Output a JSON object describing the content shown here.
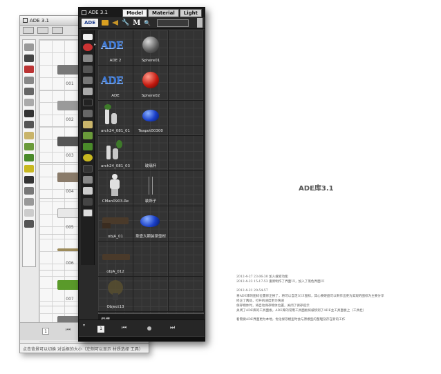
{
  "back_window": {
    "title": "ADE 3.1",
    "toolbar": [
      "",
      "",
      ""
    ],
    "cell_labels": [
      "001",
      "002",
      "003",
      "004",
      "005",
      "006",
      "007",
      "008"
    ],
    "page_number": "1",
    "status_text": "点击背景可以切换 对话框的大小（左侧可以显示 材质选择 工具）"
  },
  "front_window": {
    "title": "ADE 3.1",
    "tabs": [
      {
        "label": "Model",
        "active": true
      },
      {
        "label": "Material",
        "active": false
      },
      {
        "label": "Light",
        "active": false
      }
    ],
    "logo": "ADE",
    "m_label": "M",
    "search_value": "",
    "thumbnails": [
      {
        "label": "ADE 2",
        "kind": "ade"
      },
      {
        "label": "Sphere01",
        "kind": "sphere-gray"
      },
      {
        "label": "ADE",
        "kind": "ade"
      },
      {
        "label": "Sphere02",
        "kind": "sphere-red"
      },
      {
        "label": "arch24_081_01",
        "kind": "vase"
      },
      {
        "label": "Teapot00300",
        "kind": "teapot"
      },
      {
        "label": "arch24_081_03",
        "kind": "vase"
      },
      {
        "label": "玻璃杯",
        "kind": "empty"
      },
      {
        "label": "CMan0903-Re",
        "kind": "man"
      },
      {
        "label": "装饰子",
        "kind": "rods"
      },
      {
        "label": "objA_01",
        "kind": "sofa"
      },
      {
        "label": "茶壶大颗装茶壶材",
        "kind": "teapot-blue"
      },
      {
        "label": "objA_012",
        "kind": "sofa"
      },
      {
        "label": "",
        "kind": "blank"
      },
      {
        "label": "Object13",
        "kind": "plant"
      },
      {
        "label": "",
        "kind": "blank"
      }
    ],
    "section_label": "假懂",
    "page_number": "1",
    "controls": {
      "prev": "⏮",
      "next": "⏭"
    }
  },
  "document": {
    "title": "ADE库3.1",
    "lines": [
      "2012-4-27 23:06:30 加入搜索功能",
      "2012-4-23 15:17:53 重新制作了界面UI，加入了黑色界面UI",
      "",
      "2012-4-21 20:54:57",
      "将ADE库的图标位置修正换了，将可以自定义UI图标，其心要硬盘可以制作出更为美观的图标为主要分享",
      "修正了两处，打开的速度更为快速",
      "保存物体时，将自动保存物体位置，关闭了保存提示",
      "关闭了ADE库的工具面板，ADE库的常用工具面板将被移到了ADE主工具面板上（工具栏）",
      "",
      "看需要ADE界面更为本地，优化保存模型时会与原模型的整理及存在新的工作"
    ]
  }
}
